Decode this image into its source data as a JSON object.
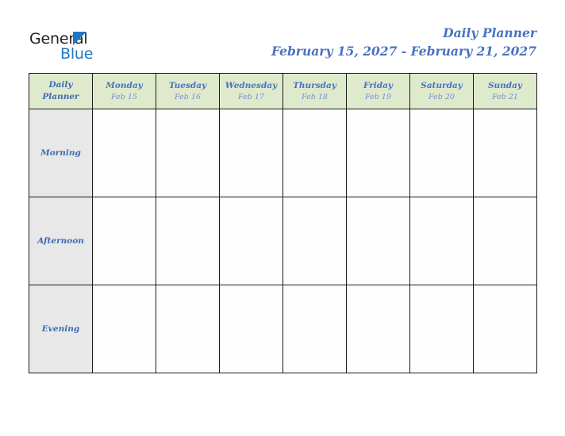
{
  "logo": {
    "word_one": "General",
    "word_two": "Blue",
    "triangle_icon": "triangle-icon",
    "brand_blue": "#1f77c4",
    "brand_dark": "#231f20"
  },
  "header": {
    "title": "Daily Planner",
    "date_range": "February 15, 2027 - February 21, 2027",
    "title_color": "#4a72c0"
  },
  "table": {
    "corner": {
      "line1": "Daily",
      "line2": "Planner"
    },
    "header_bg": "#dfeacd",
    "label_bg": "#e8e8e8",
    "cell_bg": "#fdfdfd",
    "border_color": "#1a1a1a",
    "columns": [
      {
        "name": "Monday",
        "date": "Feb 15"
      },
      {
        "name": "Tuesday",
        "date": "Feb 16"
      },
      {
        "name": "Wednesday",
        "date": "Feb 17"
      },
      {
        "name": "Thursday",
        "date": "Feb 18"
      },
      {
        "name": "Friday",
        "date": "Feb 19"
      },
      {
        "name": "Saturday",
        "date": "Feb 20"
      },
      {
        "name": "Sunday",
        "date": "Feb 21"
      }
    ],
    "rows": [
      {
        "label": "Morning",
        "cells": [
          "",
          "",
          "",
          "",
          "",
          "",
          ""
        ]
      },
      {
        "label": "Afternoon",
        "cells": [
          "",
          "",
          "",
          "",
          "",
          "",
          ""
        ]
      },
      {
        "label": "Evening",
        "cells": [
          "",
          "",
          "",
          "",
          "",
          "",
          ""
        ]
      }
    ]
  }
}
